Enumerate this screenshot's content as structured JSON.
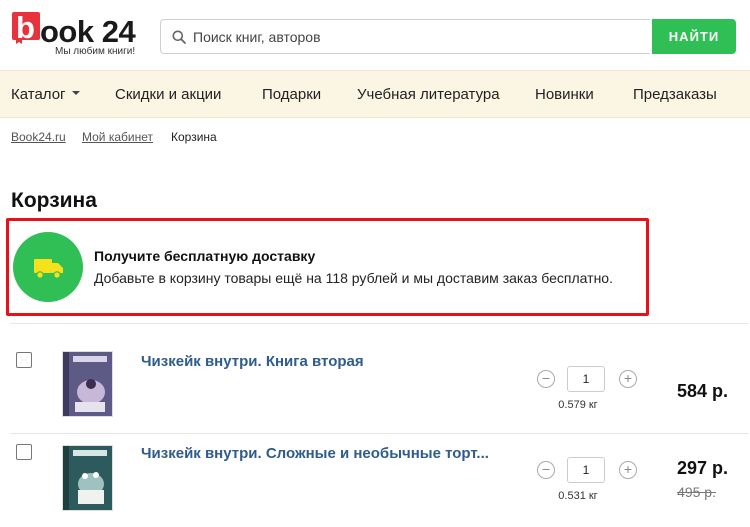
{
  "header": {
    "logo_b": "b",
    "logo_rest": "ook 24",
    "logo_tagline": "Мы любим книги!",
    "search_placeholder": "Поиск книг, авторов",
    "search_button": "НАЙТИ"
  },
  "nav": {
    "items": [
      "Каталог",
      "Скидки и акции",
      "Подарки",
      "Учебная литература",
      "Новинки",
      "Предзаказы"
    ]
  },
  "breadcrumb": {
    "items": [
      "Book24.ru",
      "Мой кабинет",
      "Корзина"
    ]
  },
  "page_title": "Корзина",
  "banner": {
    "title": "Получите бесплатную доставку",
    "text": "Добавьте в корзину товары ещё на 118 рублей и мы доставим заказ бесплатно."
  },
  "cart": {
    "items": [
      {
        "title": "Чизкейк внутри. Книга вторая",
        "qty": "1",
        "weight": "0.579 кг",
        "price": "584 р.",
        "old_price": ""
      },
      {
        "title": "Чизкейк внутри. Сложные и необычные торт...",
        "qty": "1",
        "weight": "0.531 кг",
        "price": "297 р.",
        "old_price": "495 р."
      }
    ]
  },
  "colors": {
    "accent_green": "#2fbf55",
    "logo_red": "#e8333c",
    "banner_border": "#e8101a",
    "link_blue": "#2f5c8a",
    "nav_bg": "#fbf5e3"
  }
}
